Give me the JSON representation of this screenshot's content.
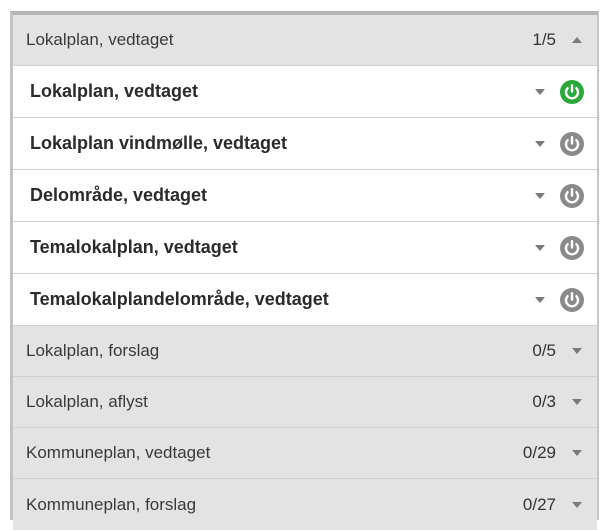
{
  "groups": [
    {
      "label": "Lokalplan, vedtaget",
      "count": "1/5",
      "expanded": true,
      "caret_icon": "chevron-up-icon"
    },
    {
      "label": "Lokalplan, forslag",
      "count": "0/5",
      "expanded": false,
      "caret_icon": "chevron-down-icon"
    },
    {
      "label": "Lokalplan, aflyst",
      "count": "0/3",
      "expanded": false,
      "caret_icon": "chevron-down-icon"
    },
    {
      "label": "Kommuneplan, vedtaget",
      "count": "0/29",
      "expanded": false,
      "caret_icon": "chevron-down-icon"
    },
    {
      "label": "Kommuneplan, forslag",
      "count": "0/27",
      "expanded": false,
      "caret_icon": "chevron-down-icon"
    }
  ],
  "layers": [
    {
      "label": "Lokalplan, vedtaget",
      "on": true,
      "toggle_icon": "power-on-icon"
    },
    {
      "label": "Lokalplan vindmølle, vedtaget",
      "on": false,
      "toggle_icon": "power-off-icon"
    },
    {
      "label": "Delområde, vedtaget",
      "on": false,
      "toggle_icon": "power-off-icon"
    },
    {
      "label": "Temalokalplan, vedtaget",
      "on": false,
      "toggle_icon": "power-off-icon"
    },
    {
      "label": "Temalokalplandelområde, vedtaget",
      "on": false,
      "toggle_icon": "power-off-icon"
    }
  ],
  "colors": {
    "power_on": "#2aa83a",
    "power_off": "#8a8a8a",
    "caret": "#7a7a7a",
    "group_bg": "#e3e3e3"
  }
}
